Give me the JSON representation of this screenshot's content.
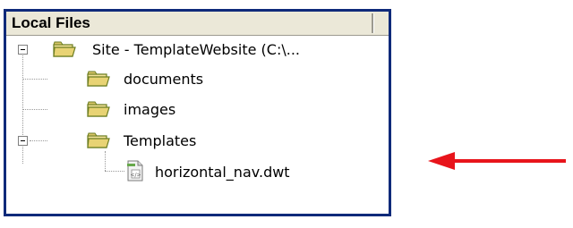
{
  "panel": {
    "title": "Local Files",
    "tree": {
      "root": {
        "label": "Site - TemplateWebsite (C:\\...",
        "icon": "folder-icon",
        "expanded": true
      },
      "children": [
        {
          "label": "documents",
          "icon": "folder-icon"
        },
        {
          "label": "images",
          "icon": "folder-icon"
        },
        {
          "label": "Templates",
          "icon": "folder-icon",
          "expanded": true,
          "children": [
            {
              "label": "horizontal_nav.dwt",
              "icon": "template-file-icon"
            }
          ]
        }
      ]
    }
  },
  "annotation": {
    "icon": "red-arrow-icon",
    "color": "#e8141b"
  }
}
